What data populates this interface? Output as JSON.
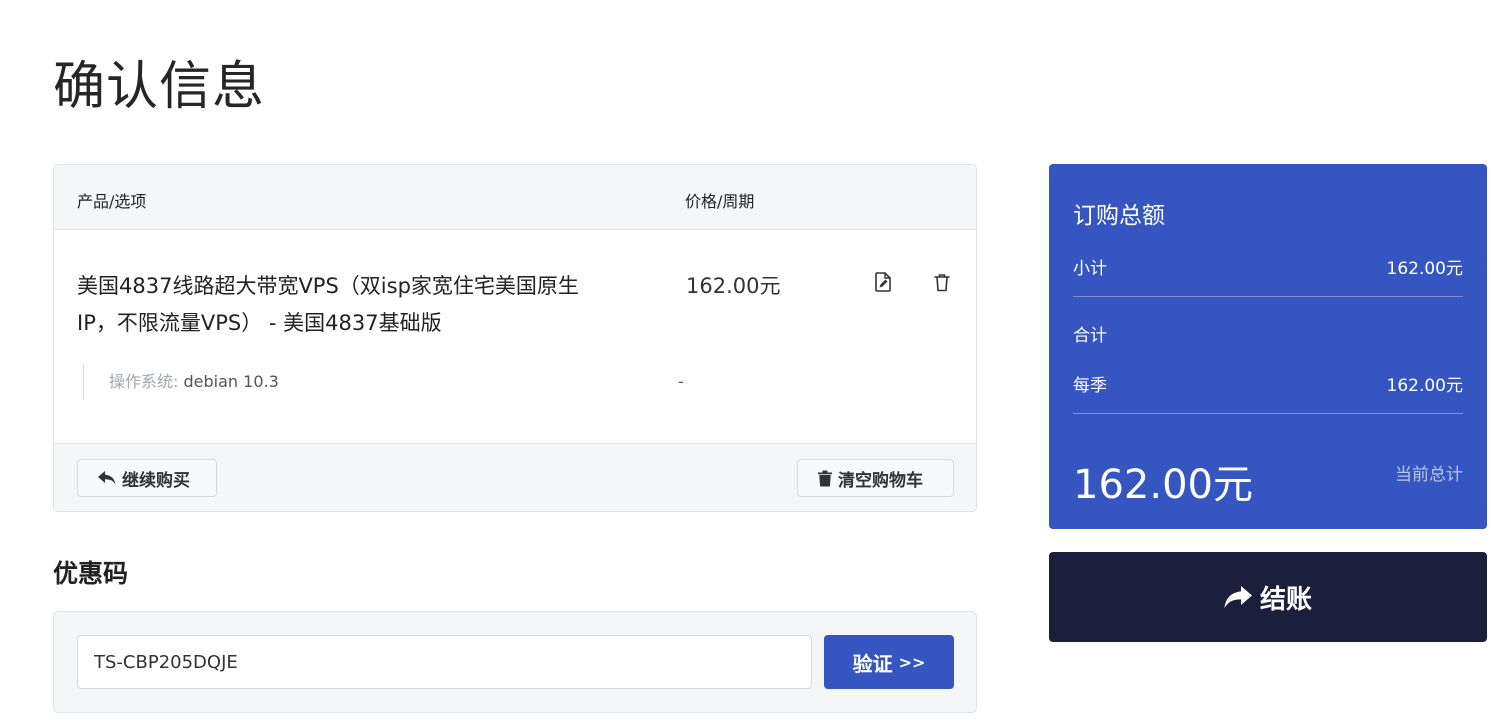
{
  "page": {
    "title": "确认信息"
  },
  "cart": {
    "header": {
      "product_col": "产品/选项",
      "price_col": "价格/周期"
    },
    "item": {
      "name_line1": "美国4837线路超大带宽VPS（双isp家宽住宅美国原生",
      "name_line2": "IP，不限流量VPS） - 美国4837基础版",
      "price": "162.00元",
      "option_label": "操作系统:",
      "option_value": "debian 10.3",
      "option_price": "-",
      "edit_icon": "file-edit-icon",
      "remove_icon": "trash-icon"
    },
    "footer": {
      "continue_label": "继续购买",
      "empty_label": "清空购物车"
    }
  },
  "coupon": {
    "title": "优惠码",
    "input_value": "TS-CBP205DQJE",
    "validate_label": "验证",
    "validate_arrows": ">>"
  },
  "summary": {
    "title": "订购总额",
    "subtotal_label": "小计",
    "subtotal_value": "162.00元",
    "total_label": "合计",
    "quarter_label": "每季",
    "quarter_value": "162.00元",
    "grand_amount": "162.00元",
    "grand_label": "当前总计"
  },
  "checkout": {
    "label": "结账"
  },
  "colors": {
    "accent": "#3556c0",
    "dark": "#1c1f3c"
  }
}
